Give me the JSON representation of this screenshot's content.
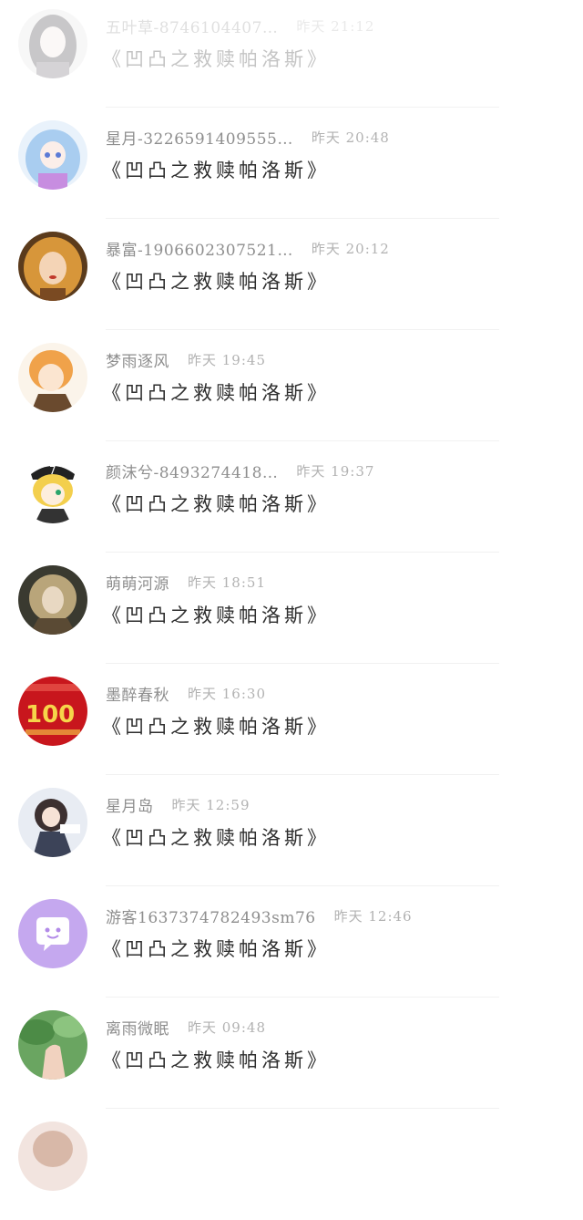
{
  "comments": [
    {
      "name": "五叶草-8746104407…",
      "time": "昨天 21:12",
      "message": "《凹凸之救赎帕洛斯》",
      "avatar_icon": "anime-girl-dark-hair-avatar-icon",
      "avatar_color": "#d9d6d8"
    },
    {
      "name": "星月-3226591409555…",
      "time": "昨天 20:48",
      "message": "《凹凸之救赎帕洛斯》",
      "avatar_icon": "anime-girl-blue-hair-avatar-icon",
      "avatar_color": "#a9cdf0"
    },
    {
      "name": "暴富-1906602307521…",
      "time": "昨天 20:12",
      "message": "《凹凸之救赎帕洛斯》",
      "avatar_icon": "girl-golden-hair-avatar-icon",
      "avatar_color": "#d7963a"
    },
    {
      "name": "梦雨逐风",
      "time": "昨天 19:45",
      "message": "《凹凸之救赎帕洛斯》",
      "avatar_icon": "anime-boy-orange-hair-avatar-icon",
      "avatar_color": "#f0a24a"
    },
    {
      "name": "颜沫兮-8493274418…",
      "time": "昨天 19:37",
      "message": "《凹凸之救赎帕洛斯》",
      "avatar_icon": "anime-boy-hat-avatar-icon",
      "avatar_color": "#f3cf4d"
    },
    {
      "name": "萌萌河源",
      "time": "昨天 18:51",
      "message": "《凹凸之救赎帕洛斯》",
      "avatar_icon": "painted-girl-curly-hair-avatar-icon",
      "avatar_color": "#8a7a5a"
    },
    {
      "name": "墨醉春秋",
      "time": "昨天 16:30",
      "message": "《凹凸之救赎帕洛斯》",
      "avatar_icon": "red-100-anniversary-avatar-icon",
      "avatar_color": "#c8161d"
    },
    {
      "name": "星月岛",
      "time": "昨天 12:59",
      "message": "《凹凸之救赎帕洛斯》",
      "avatar_icon": "anime-girl-dark-outfit-avatar-icon",
      "avatar_color": "#3c4358"
    },
    {
      "name": "游客1637374782493sm76",
      "time": "昨天 12:46",
      "message": "《凹凸之救赎帕洛斯》",
      "avatar_icon": "chat-bubble-avatar-icon",
      "avatar_color": "#c5a8ef"
    },
    {
      "name": "离雨微眠",
      "time": "昨天 09:48",
      "message": "《凹凸之救赎帕洛斯》",
      "avatar_icon": "hand-green-leaves-avatar-icon",
      "avatar_color": "#6aa561"
    }
  ]
}
